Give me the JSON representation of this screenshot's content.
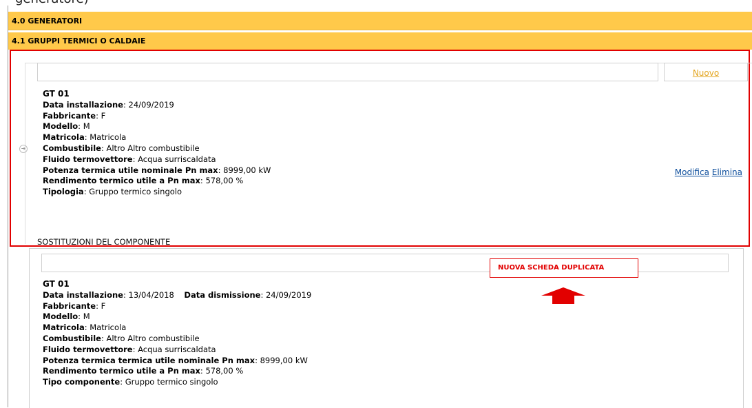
{
  "top_fragment": "generatore)",
  "sections": {
    "generatori": "4.0 GENERATORI",
    "gruppi_termici": "4.1 GRUPPI TERMICI O CALDAIE"
  },
  "toolbar": {
    "new_link": "Nuovo"
  },
  "current_component": {
    "code": "GT 01",
    "fields": [
      {
        "label": "Data installazione",
        "value": "24/09/2019"
      },
      {
        "label": "Fabbricante",
        "value": "F"
      },
      {
        "label": "Modello",
        "value": "M"
      },
      {
        "label": "Matricola",
        "value": "Matricola"
      },
      {
        "label": "Combustibile",
        "value": "Altro Altro combustibile"
      },
      {
        "label": "Fluido termovettore",
        "value": "Acqua surriscaldata"
      },
      {
        "label": "Potenza termica utile nominale Pn max",
        "value": "8999,00 kW"
      },
      {
        "label": "Rendimento termico utile a Pn max",
        "value": "578,00 %"
      },
      {
        "label": "Tipologia",
        "value": "Gruppo termico singolo"
      }
    ],
    "actions": {
      "edit": "Modifica",
      "delete": "Elimina"
    },
    "expand_icon": "circle-arrow-icon"
  },
  "replacements": {
    "heading": "SOSTITUZIONI DEL COMPONENTE",
    "annotation": "NUOVA SCHEDA DUPLICATA",
    "annotation_color": "#e20000",
    "arrow_icon": "up-arrow-icon",
    "item": {
      "code": "GT 01",
      "install_label": "Data installazione",
      "install_value": "13/04/2018",
      "dismiss_label": "Data dismissione",
      "dismiss_value": "24/09/2019",
      "fields": [
        {
          "label": "Fabbricante",
          "value": "F"
        },
        {
          "label": "Modello",
          "value": "M"
        },
        {
          "label": "Matricola",
          "value": "Matricola"
        },
        {
          "label": "Combustibile",
          "value": "Altro Altro combustibile"
        },
        {
          "label": "Fluido termovettore",
          "value": "Acqua surriscaldata"
        },
        {
          "label": "Potenza termica termica utile nominale Pn max",
          "value": "8999,00 kW"
        },
        {
          "label": "Rendimento termico utile a Pn max",
          "value": "578,00 %"
        },
        {
          "label": "Tipo componente",
          "value": "Gruppo termico singolo"
        }
      ]
    }
  },
  "colors": {
    "section_bar": "#ffc94a",
    "highlight_border": "#e10000",
    "link": "#0b4c9b",
    "new_link": "#e3a51f"
  }
}
